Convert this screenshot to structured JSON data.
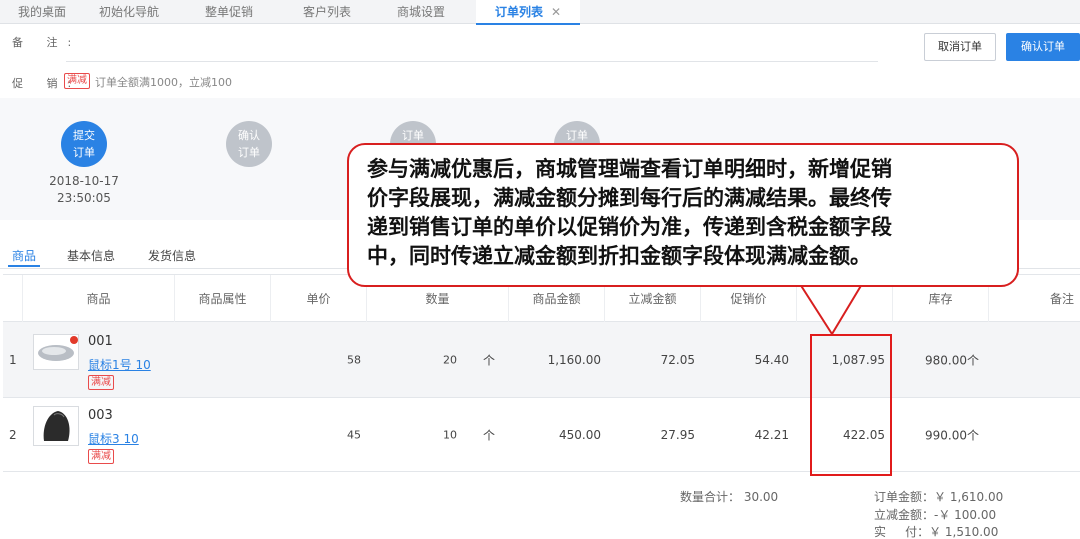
{
  "tabs": [
    {
      "label": "我的桌面"
    },
    {
      "label": "初始化导航"
    },
    {
      "label": "整单促销"
    },
    {
      "label": "客户列表"
    },
    {
      "label": "商城设置"
    },
    {
      "label": "订单列表",
      "close": "✕"
    }
  ],
  "form": {
    "remark_label": "备 注:",
    "promo_label": "促 销:",
    "promo_tag": "满减",
    "promo_text": "订单全额满1000，立减100"
  },
  "buttons": {
    "cancel": "取消订单",
    "confirm": "确认订单"
  },
  "steps": [
    {
      "line1": "提交",
      "line2": "订单",
      "date": "2018-10-17",
      "time": "23:50:05",
      "state": "done"
    },
    {
      "line1": "确认",
      "line2": "订单",
      "state": "todo"
    },
    {
      "line1": "订单",
      "line2": "",
      "state": "todo"
    },
    {
      "line1": "订单",
      "line2": "",
      "state": "todo"
    }
  ],
  "detail_tabs": [
    "商品",
    "基本信息",
    "发货信息"
  ],
  "table": {
    "headers": [
      "商品",
      "商品属性",
      "单价",
      "数量",
      "商品金额",
      "立减金额",
      "促销价",
      "库存",
      "备注"
    ],
    "rows": [
      {
        "index": "1",
        "code": "001",
        "name": "鼠标1号 10",
        "tag": "满减",
        "unit_price": "58",
        "qty": "20",
        "unit": "个",
        "amount": "1,160.00",
        "discount": "72.05",
        "promo_price": "54.40",
        "result": "1,087.95",
        "stock": "980.00个"
      },
      {
        "index": "2",
        "code": "003",
        "name": "鼠标3 10",
        "tag": "满减",
        "unit_price": "45",
        "qty": "10",
        "unit": "个",
        "amount": "450.00",
        "discount": "27.95",
        "promo_price": "42.21",
        "result": "422.05",
        "stock": "990.00个"
      }
    ]
  },
  "summary": {
    "qty_total": "数量合计： 30.00",
    "order_amount": "订单金额：￥ 1,610.00",
    "discount_amount": "立减金额：-￥ 100.00",
    "paid": "实     付：￥ 1,510.00"
  },
  "callout": {
    "lines": [
      "参与满减优惠后，商城管理端查看订单明细时，新增促销",
      "价字段展现，满减金额分摊到每行后的满减结果。最终传",
      "递到销售订单的单价以促销价为准，传递到含税金额字段",
      "中，同时传递立减金额到折扣金额字段体现满减金额。"
    ]
  },
  "colors": {
    "accent": "#2a82e4",
    "highlight": "#e11b1b",
    "tag": "#e94b4b"
  }
}
